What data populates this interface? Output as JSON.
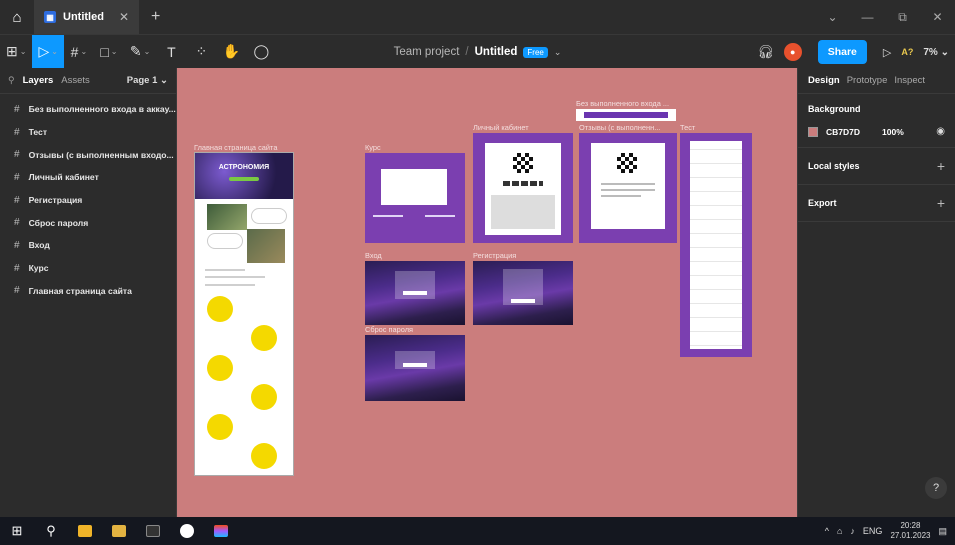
{
  "titlebar": {
    "tab_title": "Untitled",
    "tab_close": "✕",
    "new_tab": "+",
    "window_controls": [
      "⌄",
      "—",
      "⧉",
      "✕"
    ]
  },
  "toolbar": {
    "tools": [
      {
        "icon": "main-menu-icon",
        "glyph": "⊞",
        "has_dropdown": true
      },
      {
        "icon": "move-tool-icon",
        "glyph": "▷",
        "has_dropdown": true,
        "active": true
      },
      {
        "icon": "frame-tool-icon",
        "glyph": "#",
        "has_dropdown": true
      },
      {
        "icon": "shape-tool-icon",
        "glyph": "□",
        "has_dropdown": true
      },
      {
        "icon": "pen-tool-icon",
        "glyph": "✎",
        "has_dropdown": true
      },
      {
        "icon": "text-tool-icon",
        "glyph": "T"
      },
      {
        "icon": "resources-icon",
        "glyph": "⁘"
      },
      {
        "icon": "hand-tool-icon",
        "glyph": "✋"
      },
      {
        "icon": "comment-tool-icon",
        "glyph": "◯"
      }
    ],
    "team": "Team project",
    "separator": "/",
    "file_name": "Untitled",
    "plan_badge": "Free",
    "share_label": "Share",
    "ask_label": "A?",
    "zoom": "7%"
  },
  "left_panel": {
    "tabs": {
      "layers": "Layers",
      "assets": "Assets"
    },
    "page": "Page 1",
    "layers": [
      "Без выполненного входа в аккау...",
      "Тест",
      "Отзывы (с выполненным входо...",
      "Личный кабинет",
      "Регистрация",
      "Сброс пароля",
      "Вход",
      "Курс",
      "Главная страница сайта"
    ]
  },
  "canvas": {
    "background": "#CB7D7D",
    "frame_labels": {
      "main": "Главная страница сайта",
      "course": "Курс",
      "cabinet": "Личный кабинет",
      "no_login": "Без выполненного входа ...",
      "reviews": "Отзывы (с выполненн...",
      "test": "Тест",
      "login": "Вход",
      "register": "Регистрация",
      "reset": "Сброс пароля"
    },
    "hero_title": "АСТРОНОМИЯ"
  },
  "right_panel": {
    "tabs": [
      "Design",
      "Prototype",
      "Inspect"
    ],
    "background_title": "Background",
    "background_hex": "CB7D7D",
    "background_opacity": "100%",
    "local_styles": "Local styles",
    "export": "Export",
    "help": "?"
  },
  "taskbar": {
    "language": "ENG",
    "time": "20:28",
    "date": "27.01.2023"
  }
}
